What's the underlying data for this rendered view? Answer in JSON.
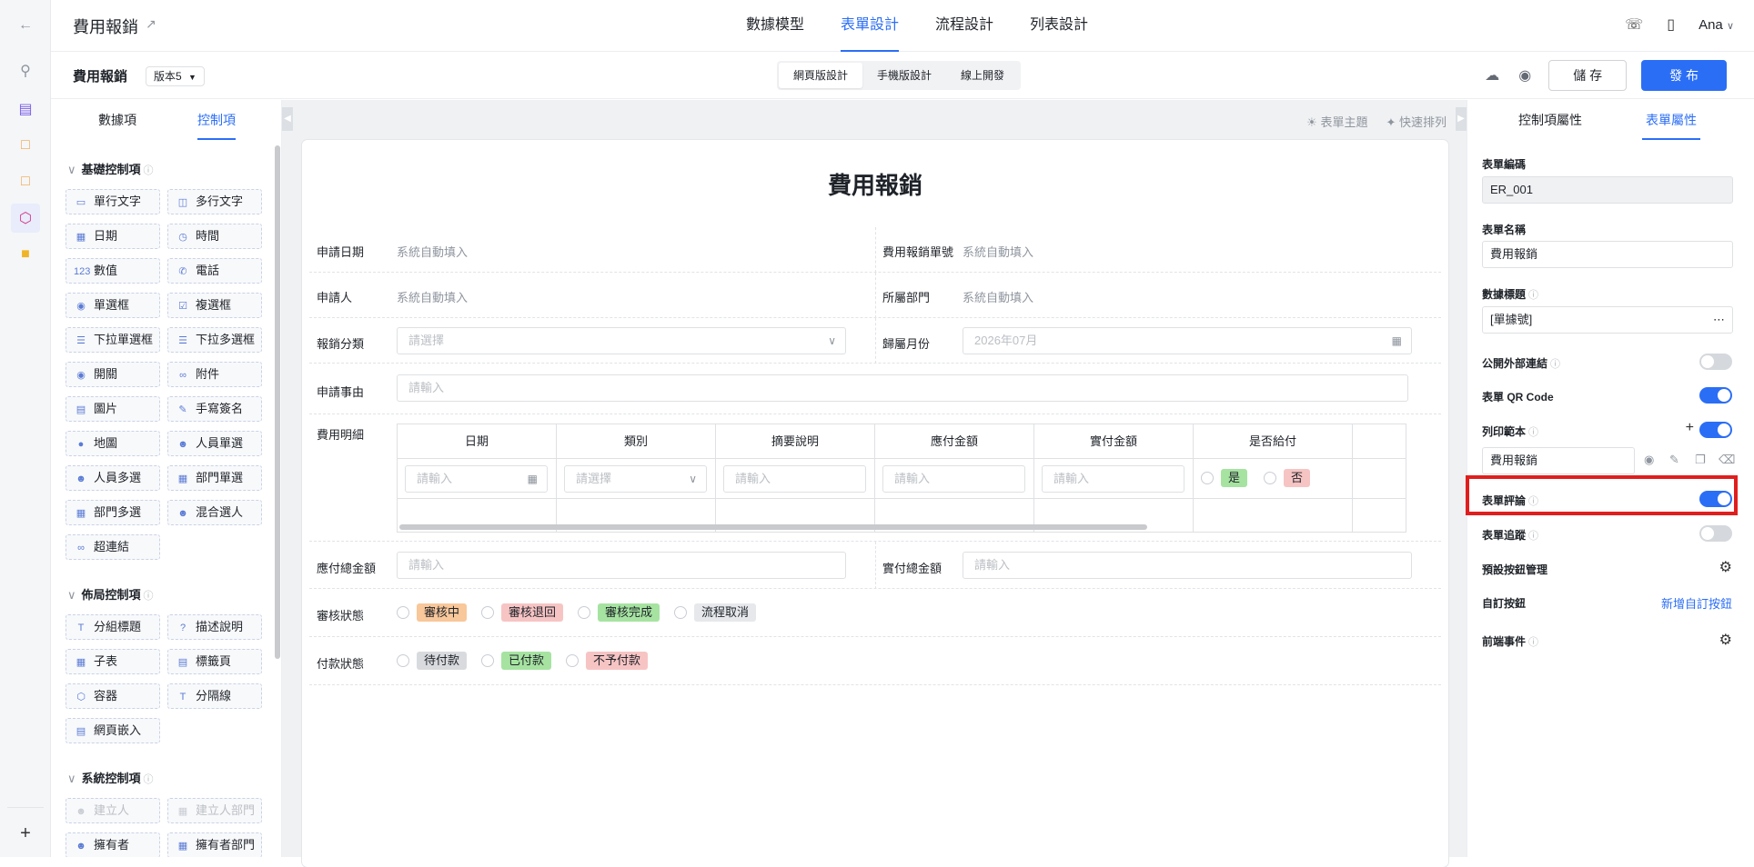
{
  "header": {
    "app_title": "費用報銷",
    "tabs": [
      {
        "label": "數據模型"
      },
      {
        "label": "表單設計"
      },
      {
        "label": "流程設計"
      },
      {
        "label": "列表設計"
      }
    ],
    "active_tab": "表單設計",
    "user_name": "Ana"
  },
  "subbar": {
    "form_title": "費用報銷",
    "version": "版本5",
    "modes": [
      "網頁版設計",
      "手機版設計",
      "線上開發"
    ],
    "save_label": "儲 存",
    "publish_label": "發 布"
  },
  "left_panel": {
    "tabs": [
      "數據項",
      "控制項"
    ],
    "groups": [
      {
        "title": "基礎控制項",
        "items": [
          "單行文字",
          "多行文字",
          "日期",
          "時間",
          "數值",
          "電話",
          "單選框",
          "複選框",
          "下拉單選框",
          "下拉多選框",
          "開關",
          "附件",
          "圖片",
          "手寫簽名",
          "地圖",
          "人員單選",
          "人員多選",
          "部門單選",
          "部門多選",
          "混合選人",
          "超連結"
        ]
      },
      {
        "title": "佈局控制項",
        "items": [
          "分組標題",
          "描述說明",
          "子表",
          "標籤頁",
          "容器",
          "分隔線",
          "網頁嵌入"
        ]
      },
      {
        "title": "系統控制項",
        "items": [
          "建立人",
          "建立人部門",
          "擁有者",
          "擁有者部門"
        ]
      }
    ]
  },
  "canvas": {
    "tools": [
      "表單主題",
      "快速排列"
    ],
    "form_title": "費用報銷",
    "fields": {
      "apply_date": {
        "label": "申請日期",
        "value": "系統自動填入"
      },
      "claim_no": {
        "label": "費用報銷單號",
        "value": "系統自動填入"
      },
      "applicant": {
        "label": "申請人",
        "value": "系統自動填入"
      },
      "department": {
        "label": "所屬部門",
        "value": "系統自動填入"
      },
      "category": {
        "label": "報銷分類",
        "placeholder": "請選擇"
      },
      "month": {
        "label": "歸屬月份",
        "placeholder": "2026年07月"
      },
      "reason": {
        "label": "申請事由",
        "placeholder": "請輸入"
      },
      "details": {
        "label": "費用明細"
      },
      "total_payable": {
        "label": "應付總金額",
        "placeholder": "請輸入"
      },
      "total_paid": {
        "label": "實付總金額",
        "placeholder": "請輸入"
      },
      "review_status": {
        "label": "審核狀態"
      },
      "payment_status": {
        "label": "付款狀態"
      }
    },
    "subtable": {
      "columns": [
        "日期",
        "類別",
        "摘要說明",
        "應付金額",
        "實付金額",
        "是否給付"
      ],
      "placeholders": [
        "請輸入",
        "請選擇",
        "請輸入",
        "請輸入",
        "請輸入"
      ],
      "yes": "是",
      "no": "否"
    },
    "review_options": [
      {
        "label": "審核中",
        "color": "#f8c79a"
      },
      {
        "label": "審核退回",
        "color": "#f7c4c4"
      },
      {
        "label": "審核完成",
        "color": "#a6e3a1"
      },
      {
        "label": "流程取消",
        "color": "#e6e8eb"
      }
    ],
    "payment_options": [
      {
        "label": "待付款",
        "color": "#d8dade"
      },
      {
        "label": "已付款",
        "color": "#a6e3a1"
      },
      {
        "label": "不予付款",
        "color": "#f7c4c4"
      }
    ]
  },
  "right_panel": {
    "tabs": [
      "控制項屬性",
      "表單屬性"
    ],
    "form_code_label": "表單編碼",
    "form_code": "ER_001",
    "form_name_label": "表單名稱",
    "form_name": "費用報銷",
    "data_title_label": "數據標題",
    "data_title": "[單據號]",
    "public_link_label": "公開外部連結",
    "public_link_on": false,
    "qr_label": "表單 QR Code",
    "qr_on": true,
    "print_label": "列印範本",
    "print_on": true,
    "print_template": "費用報銷",
    "comment_label": "表單評論",
    "comment_on": true,
    "trace_label": "表單追蹤",
    "trace_on": false,
    "default_btn_label": "預設按鈕管理",
    "custom_btn_label": "自訂按鈕",
    "custom_btn_link": "新增自訂按鈕",
    "frontend_event_label": "前端事件"
  }
}
